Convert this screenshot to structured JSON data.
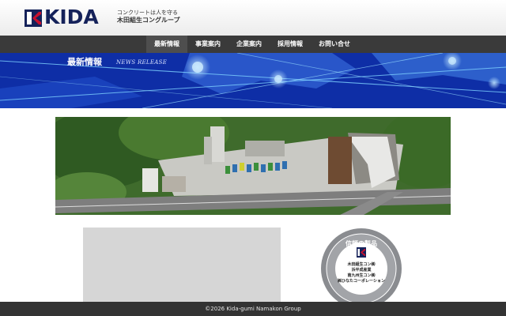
{
  "header": {
    "logo_text": "KIDA",
    "tagline": "コンクリートは人を守る",
    "group_name": "木田組生コングループ"
  },
  "nav": {
    "items": [
      {
        "label": "最新情報",
        "active": true
      },
      {
        "label": "事業案内",
        "active": false
      },
      {
        "label": "企業案内",
        "active": false
      },
      {
        "label": "採用情報",
        "active": false
      },
      {
        "label": "お問い合せ",
        "active": false
      }
    ]
  },
  "hero": {
    "title": "最新情報",
    "subtitle": "NEWS RELEASE"
  },
  "seal": {
    "top_text": "信頼の製品",
    "line1": "木田組生コン㈱",
    "line2": "浜平成産業",
    "line3": "南九州生コン㈱",
    "line4": "㈱ひなたコーポ",
    "line5": "レーション"
  },
  "footer": {
    "copyright": "©2026 Kida-gumi Namakon Group"
  },
  "colors": {
    "brand_navy": "#15225a",
    "brand_red": "#c8102e",
    "nav_bg": "#3a3a3a",
    "hero_blue": "#1a3fc4",
    "footer_bg": "#333333"
  }
}
